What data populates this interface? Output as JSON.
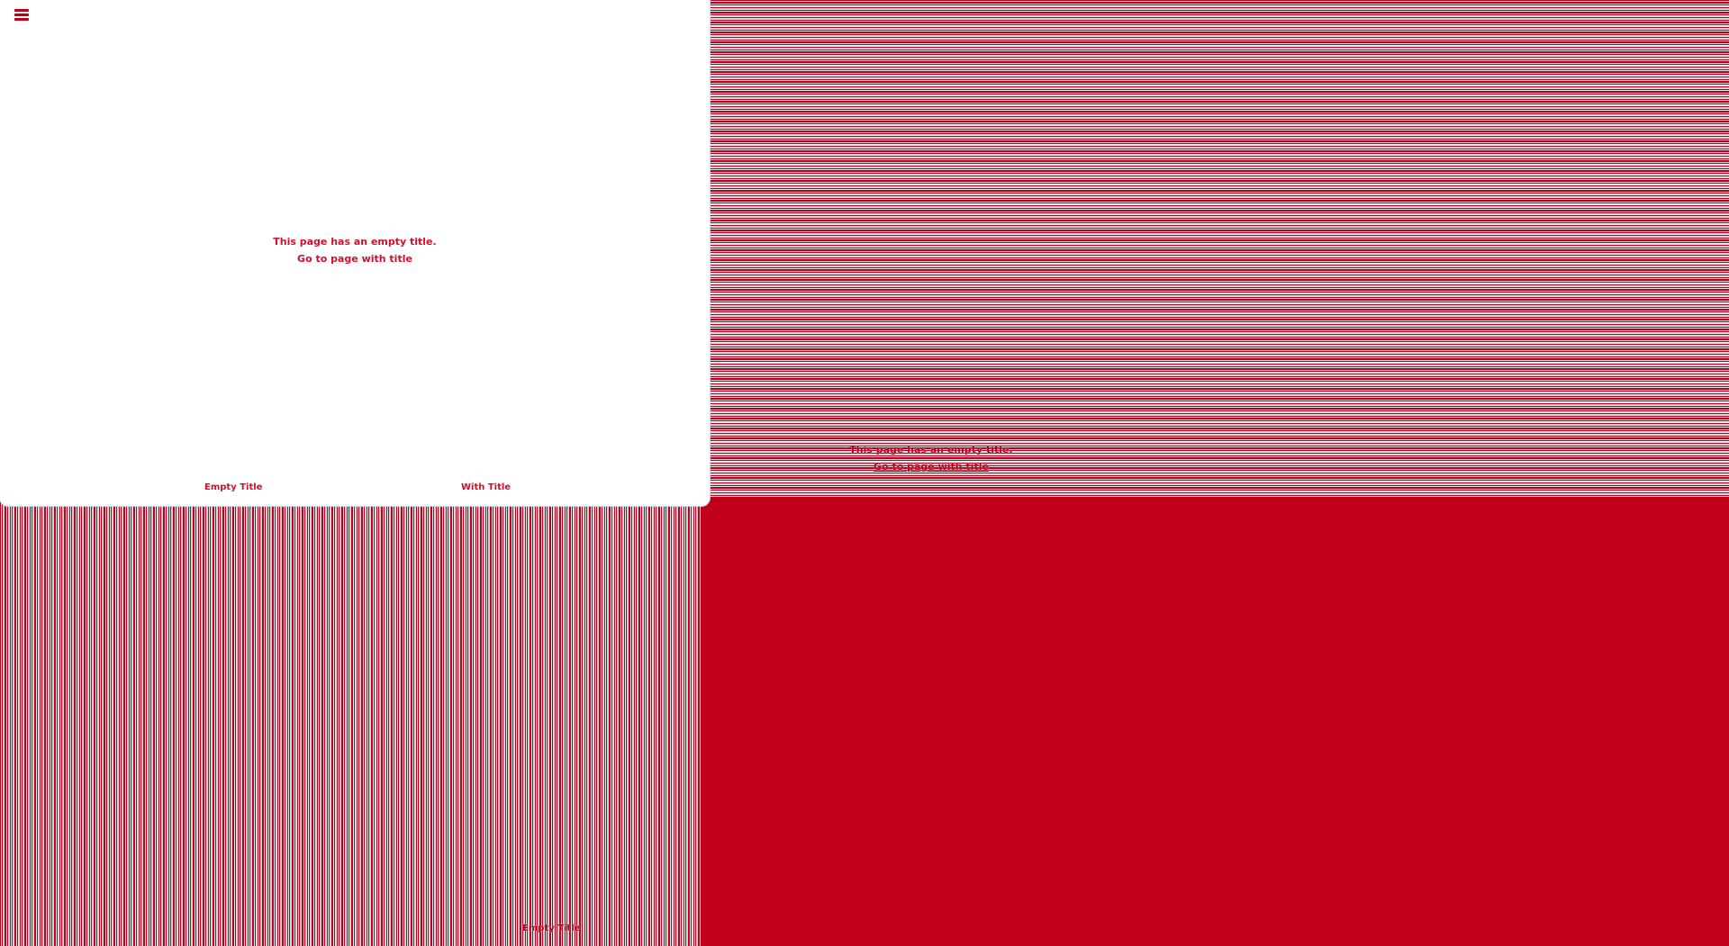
{
  "colors": {
    "accent": "#c0001a",
    "window_background": "#ffffff"
  },
  "app_window": {
    "menu_icon": "hamburger-menu-icon",
    "message": "This page has an empty title.",
    "link": "Go to page with title",
    "tabs": [
      {
        "label": "Empty Title"
      },
      {
        "label": "With Title"
      }
    ]
  },
  "background_pane": {
    "message": "This page has an empty title.",
    "link": "Go to page with title"
  },
  "bottom_pane": {
    "tab_label": "Empty Title"
  }
}
